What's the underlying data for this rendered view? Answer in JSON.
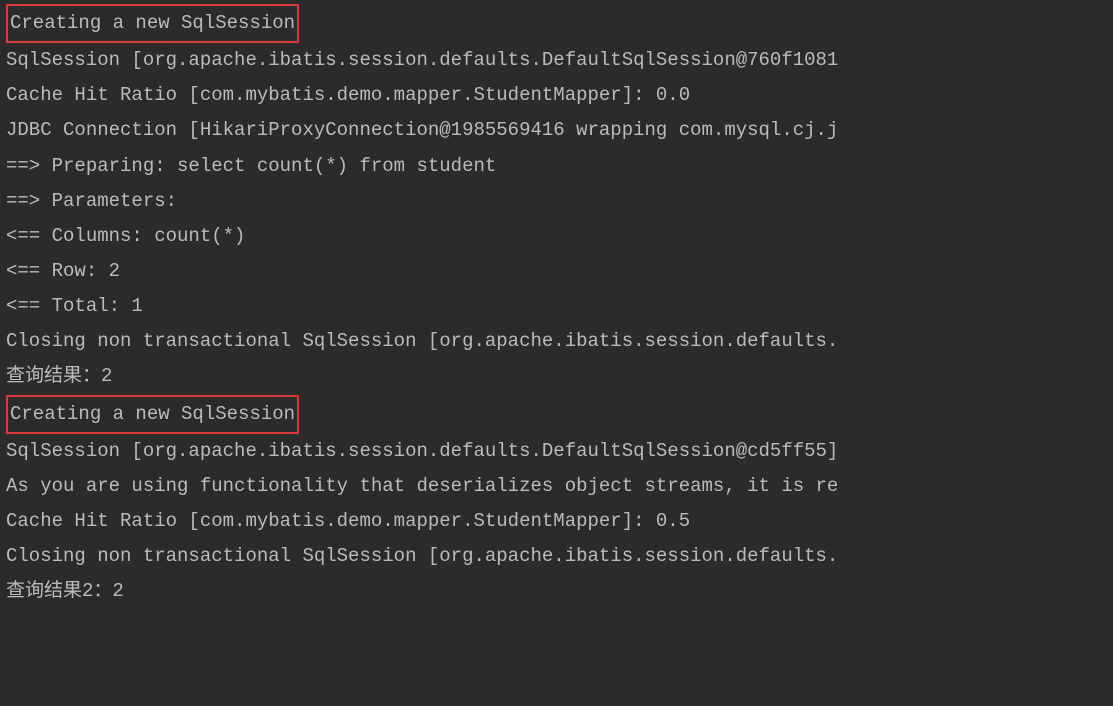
{
  "log": {
    "line1": "Creating a new SqlSession",
    "line2": "SqlSession [org.apache.ibatis.session.defaults.DefaultSqlSession@760f1081",
    "line3": "Cache Hit Ratio [com.mybatis.demo.mapper.StudentMapper]: 0.0",
    "line4": "JDBC Connection [HikariProxyConnection@1985569416 wrapping com.mysql.cj.j",
    "line5": "==>  Preparing: select count(*) from student",
    "line6": "==> Parameters:",
    "line7": "<==    Columns: count(*)",
    "line8": "<==        Row: 2",
    "line9": "<==      Total: 1",
    "line10": "Closing non transactional SqlSession [org.apache.ibatis.session.defaults.",
    "line11": "查询结果：2",
    "line12": "Creating a new SqlSession",
    "line13": "SqlSession [org.apache.ibatis.session.defaults.DefaultSqlSession@cd5ff55]",
    "line14": "As you are using functionality that deserializes object streams, it is re",
    "line15": "Cache Hit Ratio [com.mybatis.demo.mapper.StudentMapper]: 0.5",
    "line16": "Closing non transactional SqlSession [org.apache.ibatis.session.defaults.",
    "line17": "查询结果2：2"
  }
}
